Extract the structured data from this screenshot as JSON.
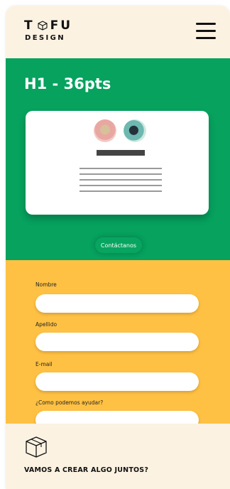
{
  "header": {
    "logo_line1_left": "T",
    "logo_line1_right": "FU",
    "logo_line2": "DESIGN"
  },
  "hero": {
    "title": "H1 - 36pts",
    "cta_label": "Contáctanos"
  },
  "form": {
    "fields": [
      {
        "label": "Nombre",
        "value": "",
        "placeholder": ""
      },
      {
        "label": "Apellido",
        "value": "",
        "placeholder": ""
      },
      {
        "label": "E-mail",
        "value": "",
        "placeholder": ""
      },
      {
        "label": "¿Como podemos ayudar?",
        "value": "",
        "placeholder": ""
      }
    ]
  },
  "footer": {
    "tagline": "VAMOS A CREAR ALGO JUNTOS?"
  },
  "colors": {
    "background": "#fbf2e2",
    "green": "#06a25e",
    "yellow": "#ffc143",
    "text": "#111111"
  },
  "icons": [
    "cube-logo-icon",
    "hamburger-menu-icon",
    "avatar-image",
    "box-icon"
  ]
}
